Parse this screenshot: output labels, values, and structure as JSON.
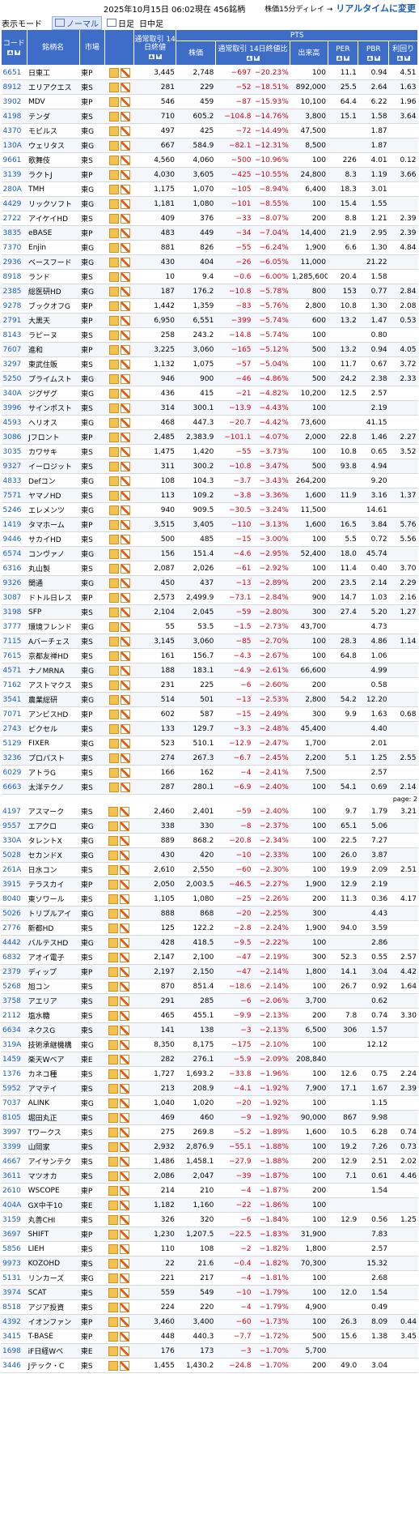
{
  "header": {
    "date": "2025年10月15日 06:02現在 456銘柄",
    "delay_note": "株価15分ディレイ →",
    "realtime_link": "リアルタイムに変更"
  },
  "modebar": {
    "label": "表示モード",
    "tabs": [
      "ノーマル",
      "日足",
      "日中足"
    ]
  },
  "columns": {
    "code": "コード",
    "name": "銘柄名",
    "market": "市場",
    "close14": "通常取引\n14日終値",
    "pts": "PTS",
    "price": "株価",
    "change": "通常取引\n14日終値比",
    "volume": "出来高",
    "per": "PER",
    "pbr": "PBR",
    "yield": "利回り"
  },
  "page_label": "page: 2",
  "rows": [
    [
      "6651",
      "日東工",
      "東P",
      "3,445",
      "2,748",
      "−697",
      "−20.23%",
      "100",
      "11.1",
      "0.94",
      "4.51"
    ],
    [
      "8912",
      "エリアクエス",
      "東S",
      "281",
      "229",
      "−52",
      "−18.51%",
      "892,000",
      "25.5",
      "2.64",
      "1.63"
    ],
    [
      "3902",
      "MDV",
      "東P",
      "546",
      "459",
      "−87",
      "−15.93%",
      "10,100",
      "64.4",
      "6.22",
      "1.96"
    ],
    [
      "4198",
      "テンダ",
      "東S",
      "710",
      "605.2",
      "−104.8",
      "−14.76%",
      "3,800",
      "15.1",
      "1.58",
      "3.64"
    ],
    [
      "4370",
      "モビルス",
      "東G",
      "497",
      "425",
      "−72",
      "−14.49%",
      "47,500",
      "",
      "1.87",
      ""
    ],
    [
      "130A",
      "ウェリタス",
      "東G",
      "667",
      "584.9",
      "−82.1",
      "−12.31%",
      "8,500",
      "",
      "1.87",
      ""
    ],
    [
      "9661",
      "歌舞伎",
      "東S",
      "4,560",
      "4,060",
      "−500",
      "−10.96%",
      "100",
      "226",
      "4.01",
      "0.12"
    ],
    [
      "3139",
      "ラクトJ",
      "東P",
      "4,030",
      "3,605",
      "−425",
      "−10.55%",
      "24,800",
      "8.3",
      "1.19",
      "3.66"
    ],
    [
      "280A",
      "TMH",
      "東G",
      "1,175",
      "1,070",
      "−105",
      "−8.94%",
      "6,400",
      "18.3",
      "3.01",
      ""
    ],
    [
      "4429",
      "リックソフト",
      "東G",
      "1,181",
      "1,080",
      "−101",
      "−8.55%",
      "100",
      "15.4",
      "1.55",
      ""
    ],
    [
      "2722",
      "アイケイHD",
      "東S",
      "409",
      "376",
      "−33",
      "−8.07%",
      "200",
      "8.8",
      "1.21",
      "2.39"
    ],
    [
      "3835",
      "eBASE",
      "東P",
      "483",
      "449",
      "−34",
      "−7.04%",
      "14,400",
      "21.9",
      "2.95",
      "2.39"
    ],
    [
      "7370",
      "Enjin",
      "東G",
      "881",
      "826",
      "−55",
      "−6.24%",
      "1,900",
      "6.6",
      "1.30",
      "4.84"
    ],
    [
      "2936",
      "ベースフード",
      "東G",
      "430",
      "404",
      "−26",
      "−6.05%",
      "11,000",
      "",
      "21.22",
      ""
    ],
    [
      "8918",
      "ランド",
      "東S",
      "10",
      "9.4",
      "−0.6",
      "−6.00%",
      "1,285,600",
      "20.4",
      "1.58",
      ""
    ],
    [
      "2385",
      "総医研HD",
      "東G",
      "187",
      "176.2",
      "−10.8",
      "−5.78%",
      "800",
      "153",
      "0.77",
      "2.84"
    ],
    [
      "9278",
      "ブックオフG",
      "東P",
      "1,442",
      "1,359",
      "−83",
      "−5.76%",
      "2,800",
      "10.8",
      "1.30",
      "2.08"
    ],
    [
      "2791",
      "大黒天",
      "東P",
      "6,950",
      "6,551",
      "−399",
      "−5.74%",
      "600",
      "13.2",
      "1.47",
      "0.53"
    ],
    [
      "8143",
      "ラピーヌ",
      "東S",
      "258",
      "243.2",
      "−14.8",
      "−5.74%",
      "100",
      "",
      "0.80",
      ""
    ],
    [
      "7607",
      "進和",
      "東P",
      "3,225",
      "3,060",
      "−165",
      "−5.12%",
      "500",
      "13.2",
      "0.94",
      "4.05"
    ],
    [
      "3297",
      "東武住販",
      "東S",
      "1,132",
      "1,075",
      "−57",
      "−5.04%",
      "100",
      "11.7",
      "0.67",
      "3.72"
    ],
    [
      "5250",
      "プライムスト",
      "東G",
      "946",
      "900",
      "−46",
      "−4.86%",
      "500",
      "24.2",
      "2.38",
      "2.33"
    ],
    [
      "340A",
      "ジグザグ",
      "東G",
      "436",
      "415",
      "−21",
      "−4.82%",
      "10,200",
      "12.5",
      "2.57",
      ""
    ],
    [
      "3996",
      "サインポスト",
      "東S",
      "314",
      "300.1",
      "−13.9",
      "−4.43%",
      "100",
      "",
      "2.19",
      ""
    ],
    [
      "4593",
      "ヘリオス",
      "東G",
      "468",
      "447.3",
      "−20.7",
      "−4.42%",
      "73,600",
      "",
      "41.15",
      ""
    ],
    [
      "3086",
      "Jフロント",
      "東P",
      "2,485",
      "2,383.9",
      "−101.1",
      "−4.07%",
      "2,000",
      "22.8",
      "1.46",
      "2.27"
    ],
    [
      "3035",
      "カワサキ",
      "東S",
      "1,475",
      "1,420",
      "−55",
      "−3.73%",
      "100",
      "10.8",
      "0.65",
      "3.52"
    ],
    [
      "9327",
      "イーロジット",
      "東S",
      "311",
      "300.2",
      "−10.8",
      "−3.47%",
      "500",
      "93.8",
      "4.94",
      ""
    ],
    [
      "4833",
      "Defコン",
      "東G",
      "108",
      "104.3",
      "−3.7",
      "−3.43%",
      "264,200",
      "",
      "9.20",
      ""
    ],
    [
      "7571",
      "ヤマノHD",
      "東S",
      "113",
      "109.2",
      "−3.8",
      "−3.36%",
      "1,600",
      "11.9",
      "3.16",
      "1.37"
    ],
    [
      "5246",
      "エレメンツ",
      "東G",
      "940",
      "909.5",
      "−30.5",
      "−3.24%",
      "11,500",
      "",
      "14.61",
      ""
    ],
    [
      "1419",
      "タマホーム",
      "東P",
      "3,515",
      "3,405",
      "−110",
      "−3.13%",
      "1,600",
      "16.5",
      "3.84",
      "5.76"
    ],
    [
      "9446",
      "サカイHD",
      "東S",
      "500",
      "485",
      "−15",
      "−3.00%",
      "100",
      "5.5",
      "0.72",
      "5.56"
    ],
    [
      "6574",
      "コンヴァノ",
      "東G",
      "156",
      "151.4",
      "−4.6",
      "−2.95%",
      "52,400",
      "18.0",
      "45.74",
      ""
    ],
    [
      "6316",
      "丸山製",
      "東S",
      "2,087",
      "2,026",
      "−61",
      "−2.92%",
      "100",
      "11.4",
      "0.40",
      "3.70"
    ],
    [
      "9326",
      "関通",
      "東G",
      "450",
      "437",
      "−13",
      "−2.89%",
      "200",
      "23.5",
      "2.14",
      "2.29"
    ],
    [
      "3087",
      "ドトル日レス",
      "東P",
      "2,573",
      "2,499.9",
      "−73.1",
      "−2.84%",
      "900",
      "14.7",
      "1.03",
      "2.16"
    ],
    [
      "3198",
      "SFP",
      "東S",
      "2,104",
      "2,045",
      "−59",
      "−2.80%",
      "300",
      "27.4",
      "5.20",
      "1.27"
    ],
    [
      "3777",
      "環境フレンド",
      "東G",
      "55",
      "53.5",
      "−1.5",
      "−2.73%",
      "43,700",
      "",
      "4.73",
      ""
    ],
    [
      "7115",
      "Aバーチェス",
      "東S",
      "3,145",
      "3,060",
      "−85",
      "−2.70%",
      "100",
      "28.3",
      "4.86",
      "1.14"
    ],
    [
      "7615",
      "京都友禅HD",
      "東S",
      "161",
      "156.7",
      "−4.3",
      "−2.67%",
      "100",
      "64.8",
      "1.06",
      ""
    ],
    [
      "4571",
      "ナノMRNA",
      "東G",
      "188",
      "183.1",
      "−4.9",
      "−2.61%",
      "66,600",
      "",
      "4.99",
      ""
    ],
    [
      "7162",
      "アストマクス",
      "東S",
      "231",
      "225",
      "−6",
      "−2.60%",
      "200",
      "",
      "0.58",
      ""
    ],
    [
      "3541",
      "農業総研",
      "東G",
      "514",
      "501",
      "−13",
      "−2.53%",
      "2,800",
      "54.2",
      "12.20",
      ""
    ],
    [
      "7071",
      "アンビスHD",
      "東P",
      "602",
      "587",
      "−15",
      "−2.49%",
      "300",
      "9.9",
      "1.63",
      "0.68"
    ],
    [
      "2743",
      "ピクセル",
      "東S",
      "133",
      "129.7",
      "−3.3",
      "−2.48%",
      "45,400",
      "",
      "4.40",
      ""
    ],
    [
      "5129",
      "FIXER",
      "東G",
      "523",
      "510.1",
      "−12.9",
      "−2.47%",
      "1,700",
      "",
      "2.01",
      ""
    ],
    [
      "3236",
      "プロパスト",
      "東S",
      "274",
      "267.3",
      "−6.7",
      "−2.45%",
      "2,200",
      "5.1",
      "1.25",
      "2.55"
    ],
    [
      "6029",
      "アトラG",
      "東S",
      "166",
      "162",
      "−4",
      "−2.41%",
      "7,500",
      "",
      "2.57",
      ""
    ],
    [
      "6663",
      "太洋テクノ",
      "東S",
      "287",
      "280.1",
      "−6.9",
      "−2.40%",
      "100",
      "54.1",
      "0.69",
      "2.14"
    ],
    [
      "4197",
      "アスマーク",
      "東S",
      "2,460",
      "2,401",
      "−59",
      "−2.40%",
      "100",
      "9.7",
      "1.79",
      "3.21"
    ],
    [
      "9557",
      "エアクロ",
      "東G",
      "338",
      "330",
      "−8",
      "−2.37%",
      "100",
      "65.1",
      "5.06",
      ""
    ],
    [
      "330A",
      "タレントX",
      "東G",
      "889",
      "868.2",
      "−20.8",
      "−2.34%",
      "100",
      "22.5",
      "7.27",
      ""
    ],
    [
      "5028",
      "セカンドX",
      "東G",
      "430",
      "420",
      "−10",
      "−2.33%",
      "100",
      "26.0",
      "3.87",
      ""
    ],
    [
      "261A",
      "日水コン",
      "東S",
      "2,610",
      "2,550",
      "−60",
      "−2.30%",
      "100",
      "19.9",
      "2.09",
      "2.51"
    ],
    [
      "3915",
      "テラスカイ",
      "東P",
      "2,050",
      "2,003.5",
      "−46.5",
      "−2.27%",
      "1,900",
      "12.9",
      "2.19",
      ""
    ],
    [
      "8040",
      "東ソワール",
      "東S",
      "1,105",
      "1,080",
      "−25",
      "−2.26%",
      "200",
      "11.3",
      "0.36",
      "4.17"
    ],
    [
      "5026",
      "トリプルアイ",
      "東G",
      "888",
      "868",
      "−20",
      "−2.25%",
      "300",
      "",
      "4.43",
      ""
    ],
    [
      "2776",
      "新都HD",
      "東S",
      "125",
      "122.2",
      "−2.8",
      "−2.24%",
      "1,900",
      "94.0",
      "3.59",
      ""
    ],
    [
      "4442",
      "バルテスHD",
      "東G",
      "428",
      "418.5",
      "−9.5",
      "−2.22%",
      "100",
      "",
      "2.86",
      ""
    ],
    [
      "6832",
      "アオイ電子",
      "東S",
      "2,147",
      "2,100",
      "−47",
      "−2.19%",
      "300",
      "52.3",
      "0.55",
      "2.57"
    ],
    [
      "2379",
      "ディップ",
      "東P",
      "2,197",
      "2,150",
      "−47",
      "−2.14%",
      "1,800",
      "14.1",
      "3.04",
      "4.42"
    ],
    [
      "5268",
      "旭コン",
      "東S",
      "870",
      "851.4",
      "−18.6",
      "−2.14%",
      "100",
      "26.7",
      "0.92",
      "1.64"
    ],
    [
      "3758",
      "アエリア",
      "東S",
      "291",
      "285",
      "−6",
      "−2.06%",
      "3,700",
      "",
      "0.62",
      ""
    ],
    [
      "2112",
      "塩水糖",
      "東S",
      "465",
      "455.1",
      "−9.9",
      "−2.13%",
      "200",
      "7.8",
      "0.74",
      "3.30"
    ],
    [
      "6634",
      "ネクスG",
      "東S",
      "141",
      "138",
      "−3",
      "−2.13%",
      "6,500",
      "306",
      "1.57",
      ""
    ],
    [
      "319A",
      "技術承継機構",
      "東G",
      "8,350",
      "8,175",
      "−175",
      "−2.10%",
      "100",
      "",
      "12.12",
      ""
    ],
    [
      "1459",
      "楽天Wベア",
      "東E",
      "282",
      "276.1",
      "−5.9",
      "−2.09%",
      "208,840",
      "",
      "",
      ""
    ],
    [
      "1376",
      "カネコ種",
      "東S",
      "1,727",
      "1,693.2",
      "−33.8",
      "−1.96%",
      "100",
      "12.6",
      "0.75",
      "2.24"
    ],
    [
      "5952",
      "アマテイ",
      "東S",
      "213",
      "208.9",
      "−4.1",
      "−1.92%",
      "7,900",
      "17.1",
      "1.67",
      "2.39"
    ],
    [
      "7037",
      "ALINK",
      "東G",
      "1,040",
      "1,020",
      "−20",
      "−1.92%",
      "100",
      "",
      "1.15",
      ""
    ],
    [
      "8105",
      "堀田丸正",
      "東S",
      "469",
      "460",
      "−9",
      "−1.92%",
      "90,000",
      "867",
      "9.98",
      ""
    ],
    [
      "3997",
      "Tワークス",
      "東S",
      "275",
      "269.8",
      "−5.2",
      "−1.89%",
      "1,600",
      "10.5",
      "6.28",
      "0.74"
    ],
    [
      "3399",
      "山岡家",
      "東S",
      "2,932",
      "2,876.9",
      "−55.1",
      "−1.88%",
      "100",
      "19.2",
      "7.26",
      "0.73"
    ],
    [
      "4667",
      "アイサンテク",
      "東S",
      "1,486",
      "1,458.1",
      "−27.9",
      "−1.88%",
      "200",
      "12.9",
      "2.51",
      "2.02"
    ],
    [
      "3611",
      "マツオカ",
      "東S",
      "2,086",
      "2,047",
      "−39",
      "−1.87%",
      "100",
      "7.1",
      "0.61",
      "4.46"
    ],
    [
      "2610",
      "WSCOPE",
      "東P",
      "214",
      "210",
      "−4",
      "−1.87%",
      "200",
      "",
      "1.54",
      ""
    ],
    [
      "404A",
      "GX中干10",
      "東E",
      "1,182",
      "1,160",
      "−22",
      "−1.86%",
      "100",
      "",
      "",
      ""
    ],
    [
      "3159",
      "丸善CHI",
      "東S",
      "326",
      "320",
      "−6",
      "−1.84%",
      "100",
      "12.9",
      "0.56",
      "1.25"
    ],
    [
      "3697",
      "SHIFT",
      "東P",
      "1,230",
      "1,207.5",
      "−22.5",
      "−1.83%",
      "31,900",
      "",
      "7.83",
      ""
    ],
    [
      "5856",
      "LIEH",
      "東S",
      "110",
      "108",
      "−2",
      "−1.82%",
      "1,800",
      "",
      "2.57",
      ""
    ],
    [
      "9973",
      "KOZOHD",
      "東S",
      "22",
      "21.6",
      "−0.4",
      "−1.82%",
      "70,300",
      "",
      "15.32",
      ""
    ],
    [
      "5131",
      "リンカーズ",
      "東G",
      "221",
      "217",
      "−4",
      "−1.81%",
      "100",
      "",
      "2.68",
      ""
    ],
    [
      "3974",
      "SCAT",
      "東S",
      "559",
      "549",
      "−10",
      "−1.79%",
      "100",
      "12.0",
      "1.54",
      ""
    ],
    [
      "8518",
      "アジア投資",
      "東S",
      "224",
      "220",
      "−4",
      "−1.79%",
      "4,900",
      "",
      "0.49",
      ""
    ],
    [
      "4392",
      "イオンファン",
      "東P",
      "3,460",
      "3,400",
      "−60",
      "−1.73%",
      "100",
      "26.3",
      "8.09",
      "0.44"
    ],
    [
      "3415",
      "T-BASE",
      "東P",
      "448",
      "440.3",
      "−7.7",
      "−1.72%",
      "500",
      "15.6",
      "1.38",
      "3.45"
    ],
    [
      "1698",
      "iF日経Wベ",
      "東E",
      "176",
      "173",
      "−3",
      "−1.70%",
      "5,700",
      "",
      "",
      ""
    ],
    [
      "3446",
      "Jテック・C",
      "東S",
      "1,455",
      "1,430.2",
      "−24.8",
      "−1.70%",
      "200",
      "49.0",
      "3.04",
      ""
    ]
  ]
}
